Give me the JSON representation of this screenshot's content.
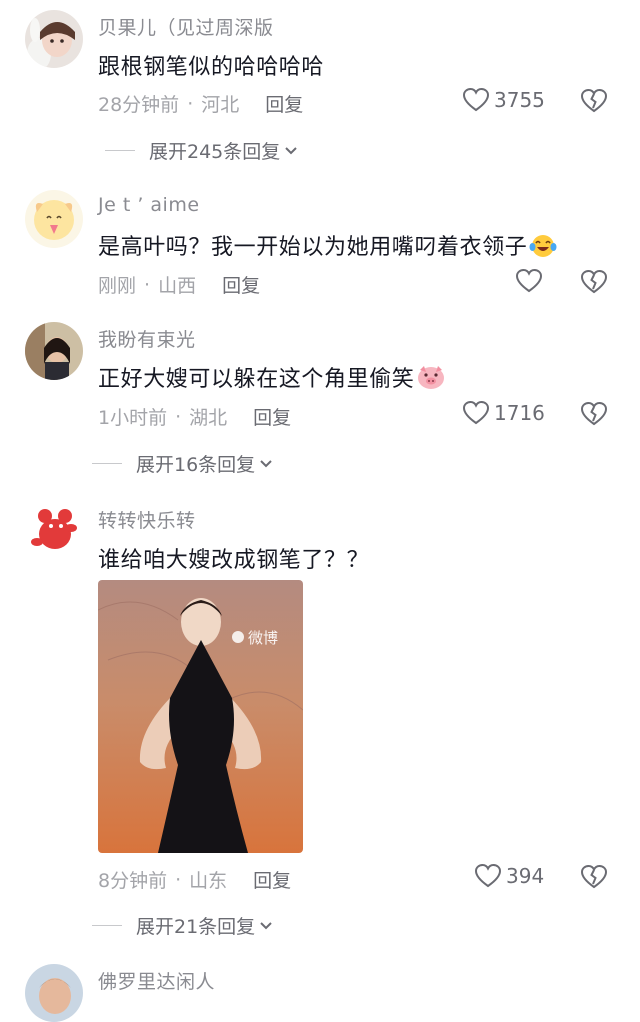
{
  "comments": [
    {
      "username": "贝果儿（见过周深版",
      "text": "跟根钢笔似的哈哈哈哈",
      "time": "28分钟前",
      "location": "河北",
      "reply_label": "回复",
      "likes": "3755",
      "expand_label": "展开245条回复"
    },
    {
      "username": "Je t ’ aime",
      "text": "是高叶吗？我一开始以为她用嘴叼着衣领子",
      "time": "刚刚",
      "location": "山西",
      "reply_label": "回复",
      "likes": ""
    },
    {
      "username": "我盼有束光",
      "text": "正好大嫂可以躲在这个角里偷笑",
      "time": "1小时前",
      "location": "湖北",
      "reply_label": "回复",
      "likes": "1716",
      "expand_label": "展开16条回复"
    },
    {
      "username": "转转快乐转",
      "text": "谁给咱大嫂改成钢笔了？？",
      "time": "8分钟前",
      "location": "山东",
      "reply_label": "回复",
      "likes": "394",
      "expand_label": "展开21条回复",
      "image_watermark": "微博"
    },
    {
      "username": "佛罗里达闲人"
    }
  ],
  "icons": {
    "like": "heart-outline-icon",
    "dislike": "broken-heart-icon",
    "expand": "chevron-down-icon",
    "emoji_laugh": "laughing-crying-emoji",
    "emoji_pig": "pig-face-emoji"
  },
  "colors": {
    "username": "#8a8b91",
    "text": "#161823",
    "meta": "#a3a4a9"
  }
}
